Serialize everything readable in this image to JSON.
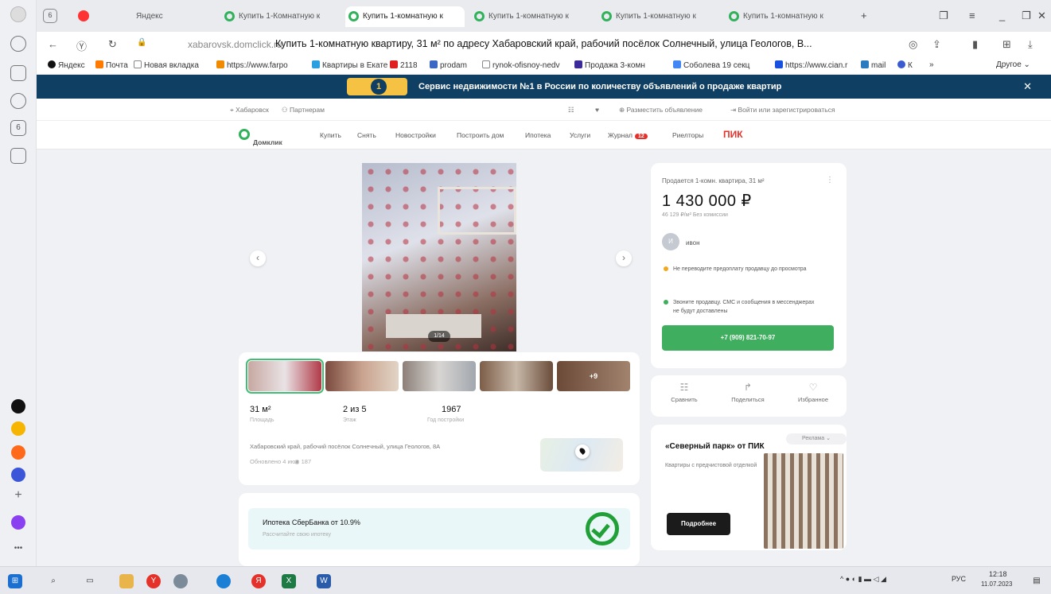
{
  "browser": {
    "tab_count": "6",
    "tabs": [
      {
        "label": "Яндекс"
      },
      {
        "label": "Купить 1-Комнатную к"
      },
      {
        "label": "Купить 1-комнатную к"
      },
      {
        "label": "Купить 1-комнатную к"
      },
      {
        "label": "Купить 1-комнатную к"
      },
      {
        "label": "Купить 1-комнатную к"
      }
    ],
    "address_domain": "xabarovsk.domclick.ru",
    "page_title": "Купить 1-комнатную квартиру, 31 м² по адресу Хабаровский край, рабочий посёлок Солнечный, улица Геологов, В...",
    "bookmarks": [
      "Яндекс",
      "Почта",
      "Новая вкладка",
      "https://www.farpo",
      "Квартиры в Екате",
      "2118",
      "prodam",
      "rynok-ofisnoy-nedv",
      "Продажа 3-комн",
      "Соболева 19 секц",
      "https://www.cian.r",
      "mail",
      "К"
    ],
    "bookmarks_more": "Другое"
  },
  "promo": {
    "badge": "1",
    "text": "Сервис недвижимости №1 в России по количеству объявлений о продаже квартир"
  },
  "site": {
    "city": "Хабаровск",
    "partners": "Партнерам",
    "post_ad": "Разместить объявление",
    "login": "Войти или зарегистрироваться",
    "logo": "Домклик",
    "nav": [
      "Купить",
      "Снять",
      "Новостройки",
      "Построить дом",
      "Ипотека",
      "Услуги",
      "Журнал",
      "Риелторы"
    ],
    "journal_badge": "12",
    "pik": "ПИК"
  },
  "listing": {
    "photo_counter": "1/14",
    "thumb_more": "+9",
    "area": "31 м²",
    "area_label": "Площадь",
    "floor": "2 из 5",
    "floor_label": "Этаж",
    "year": "1967",
    "year_label": "Год постройки",
    "address": "Хабаровский край, рабочий посёлок Солнечный, улица Геологов, 8А",
    "updated": "Обновлено 4 июл",
    "views": "187"
  },
  "sidebar": {
    "type": "Продается 1-комн. квартира, 31 м²",
    "price": "1 430 000 ₽",
    "price_sub": "46 129 ₽/м²  Без комиссии",
    "seller_initial": "И",
    "seller": "ивон",
    "warn1": "Не переводите предоплату продавцу до просмотра",
    "warn2": "Звоните продавцу. СМС и сообщения в мессенджерах не будут доставлены",
    "phone": "+7 (909) 821-70-97",
    "compare": "Сравнить",
    "share": "Поделиться",
    "favorite": "Избранное"
  },
  "ad": {
    "tag": "Реклама",
    "title": "«Северный парк» от ПИК",
    "text": "Квартиры с предчистовой отделкой",
    "button": "Подробнее"
  },
  "mortgage": {
    "title": "Ипотека СберБанка от 10.9%",
    "sub": "Рассчитайте свою ипотеку"
  },
  "taskbar": {
    "lang": "РУС",
    "time": "12:18",
    "date": "11.07.2023"
  },
  "colors": {
    "accent": "#3fae5f",
    "promo_bg": "#0f3f63",
    "pik_red": "#e4322b"
  }
}
